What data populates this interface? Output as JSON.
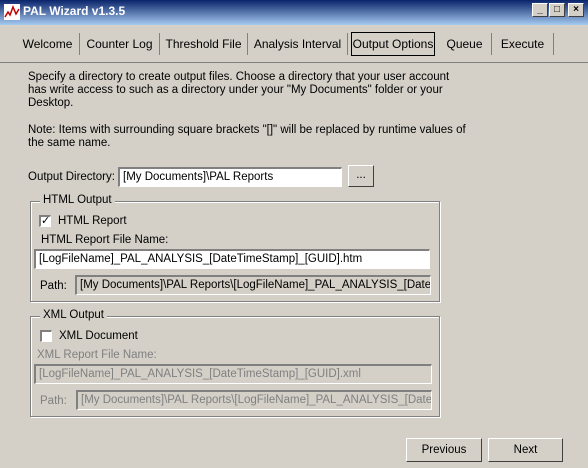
{
  "window": {
    "title": "PAL Wizard v1.3.5"
  },
  "tabs": [
    {
      "label": "Welcome"
    },
    {
      "label": "Counter Log"
    },
    {
      "label": "Threshold File"
    },
    {
      "label": "Analysis Interval"
    },
    {
      "label": "Output Options"
    },
    {
      "label": "Queue"
    },
    {
      "label": "Execute"
    }
  ],
  "active_tab": "Output Options",
  "intro": {
    "line1": "Specify a directory to create output files. Choose a directory that your user account",
    "line2": "has write access to such as a directory under your \"My Documents\" folder or your",
    "line3": "Desktop.",
    "note1": "Note: Items with surrounding square brackets \"[]\" will be replaced by runtime values of",
    "note2": "the same name."
  },
  "output_directory": {
    "label": "Output Directory:",
    "value": "[My Documents]\\PAL Reports",
    "browse_label": "..."
  },
  "html_output": {
    "group_label": "HTML Output",
    "checkbox_label": "HTML Report",
    "checked": true,
    "filename_label": "HTML Report File Name:",
    "filename_value": "[LogFileName]_PAL_ANALYSIS_[DateTimeStamp]_[GUID].htm",
    "path_label": "Path:",
    "path_value": "[My Documents]\\PAL Reports\\[LogFileName]_PAL_ANALYSIS_[DateTim"
  },
  "xml_output": {
    "group_label": "XML Output",
    "checkbox_label": "XML Document",
    "checked": false,
    "filename_label": "XML Report File Name:",
    "filename_value": "[LogFileName]_PAL_ANALYSIS_[DateTimeStamp]_[GUID].xml",
    "path_label": "Path:",
    "path_value": "[My Documents]\\PAL Reports\\[LogFileName]_PAL_ANALYSIS_[DateTim"
  },
  "footer": {
    "previous_label": "Previous",
    "next_label": "Next"
  }
}
